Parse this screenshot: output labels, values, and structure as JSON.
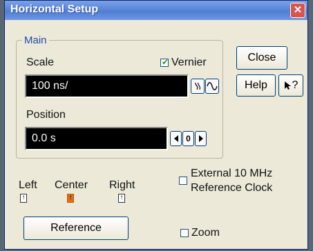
{
  "window": {
    "title": "Horizontal Setup",
    "close_glyph": "✕"
  },
  "main_group": {
    "title": "Main",
    "scale_label": "Scale",
    "vernier_label": "Vernier",
    "vernier_checked": true,
    "scale_value": "100 ns/",
    "position_label": "Position",
    "position_value": "0.0 s",
    "zero_label": "0"
  },
  "buttons": {
    "close": "Close",
    "help": "Help",
    "whatsthis": "?"
  },
  "external_clock": {
    "line1": "External 10 MHz",
    "line2": "Reference Clock",
    "checked": false
  },
  "reference": {
    "left": "Left",
    "center": "Center",
    "right": "Right",
    "selected": "Center",
    "button": "Reference"
  },
  "zoom": {
    "label": "Zoom",
    "checked": false
  },
  "icons": {
    "fine_coarse": "knob-icon",
    "wave": "waveform-icon",
    "left_arrow": "arrow-left-icon",
    "right_arrow": "arrow-right-icon",
    "pointer": "pointer-question-icon"
  },
  "colors": {
    "accent": "#1b4aa8",
    "selected_marker": "#e2700f",
    "title_bar": "#5b86d8"
  }
}
